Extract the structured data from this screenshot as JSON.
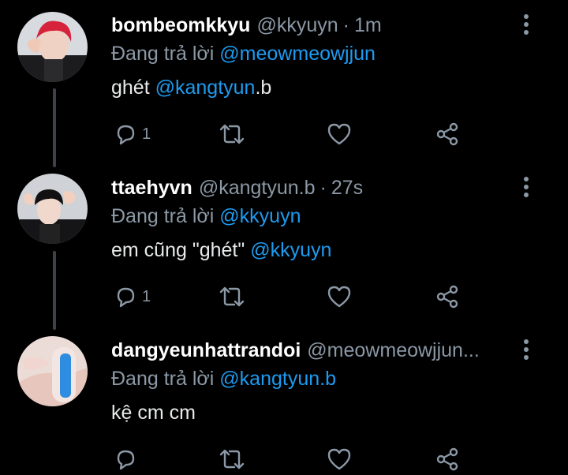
{
  "tweets": [
    {
      "name": "bombeomkkyu",
      "handle": "@kkyuyn",
      "time": "1m",
      "reply_prefix": "Đang trả lời",
      "reply_to": "@meowmeowjjun",
      "body_text": "ghét ",
      "body_mention": "@kangtyun",
      "body_suffix": ".b",
      "reply_count": "1"
    },
    {
      "name": "ttaehyvn",
      "handle": "@kangtyun.b",
      "time": "27s",
      "reply_prefix": "Đang trả lời",
      "reply_to": "@kkyuyn",
      "body_text": "em cũng \"ghét\" ",
      "body_mention": "@kkyuyn",
      "body_suffix": "",
      "reply_count": "1"
    },
    {
      "name": "dangyeunhattrandoi",
      "handle": "@meowmeowjjun...",
      "time": "",
      "reply_prefix": "Đang trả lời",
      "reply_to": "@kangtyun.b",
      "body_text": "kệ cm cm",
      "body_mention": "",
      "body_suffix": "",
      "reply_count": ""
    }
  ],
  "icons": {
    "reply": "reply-icon",
    "retweet": "retweet-icon",
    "like": "heart-icon",
    "share": "share-icon",
    "more": "more-vertical-icon"
  },
  "colors": {
    "background": "#000000",
    "mention": "#1d9bf0",
    "secondary_text": "#8b98a5",
    "thread_line": "#3d4148"
  }
}
